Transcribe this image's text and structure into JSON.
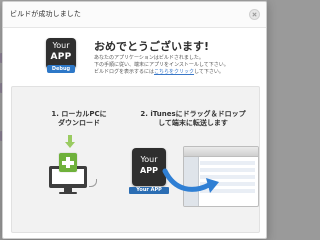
{
  "dialog": {
    "title": "ビルドが成功しました",
    "headline": "おめでとうございます!",
    "description": {
      "line1": "あなたのアプリケーションはビルドされました。",
      "line2": "下の手順に従い、端末にアプリをインストールして下さい。",
      "line3_prefix": "ビルドログを表示するには",
      "line3_link": "こちらをクリック",
      "line3_suffix": "して下さい。"
    },
    "app_icon": {
      "line1": "Your",
      "line2": "APP",
      "ribbon": "Debug"
    }
  },
  "steps": [
    {
      "title_line1": "1. ローカルPCに",
      "title_line2": "ダウンロード"
    },
    {
      "title_line1": "2. iTunesにドラッグ＆ドロップ",
      "title_line2": "して端末に転送します",
      "app_tile": {
        "line1": "Your",
        "line2": "APP",
        "label": "Your APP"
      }
    }
  ],
  "colors": {
    "link": "#3a78c8",
    "download_green": "#6fb13b",
    "arrow_blue": "#2f7fd4",
    "dark_tile": "#2e2e2e"
  }
}
